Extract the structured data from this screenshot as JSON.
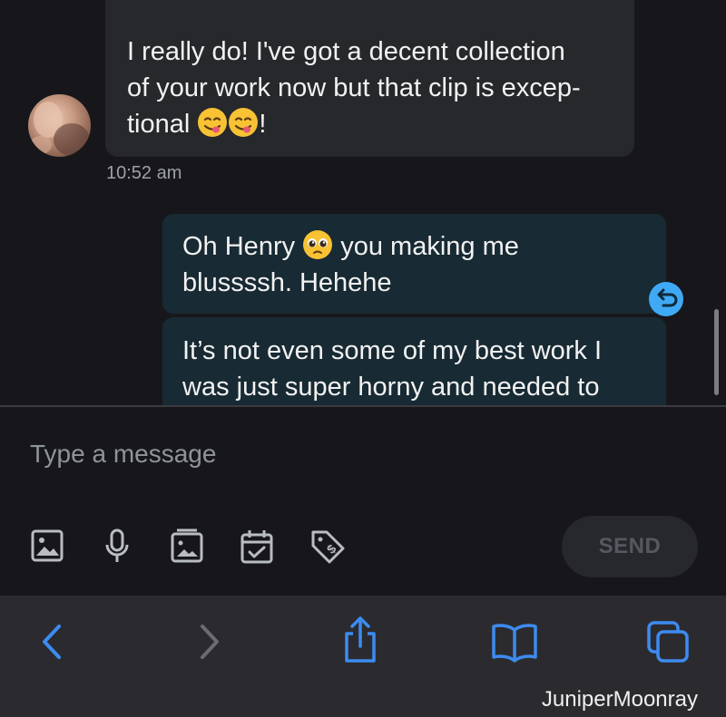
{
  "conversation": {
    "received_message": {
      "lines": [
        "I really do! I've got a decent collection",
        "of your work now but that clip is excep-",
        "tional",
        "!"
      ],
      "timestamp": "10:52 am"
    },
    "sent_messages": [
      {
        "lines": [
          "Oh Henry",
          "you making me",
          "blussssh. Hehehe"
        ]
      },
      {
        "lines": [
          "It’s not even some of my best work I",
          "was just super horny and needed to"
        ]
      }
    ]
  },
  "composer": {
    "placeholder": "Type a message",
    "send_label": "SEND",
    "tools": [
      "image-icon",
      "microphone-icon",
      "vault-icon",
      "calendar-check-icon",
      "price-tag-icon"
    ]
  },
  "browser_toolbar": {
    "buttons": [
      "back-icon",
      "forward-icon",
      "share-icon",
      "bookmarks-icon",
      "tabs-icon"
    ],
    "accent_color": "#3d8bf0",
    "disabled_color": "#6b6b70"
  },
  "watermark": "JuniperMoonray",
  "colors": {
    "background": "#17171b",
    "received_bubble": "#26282c",
    "sent_bubble": "#182a33",
    "undo_badge": "#3fa9f5"
  }
}
